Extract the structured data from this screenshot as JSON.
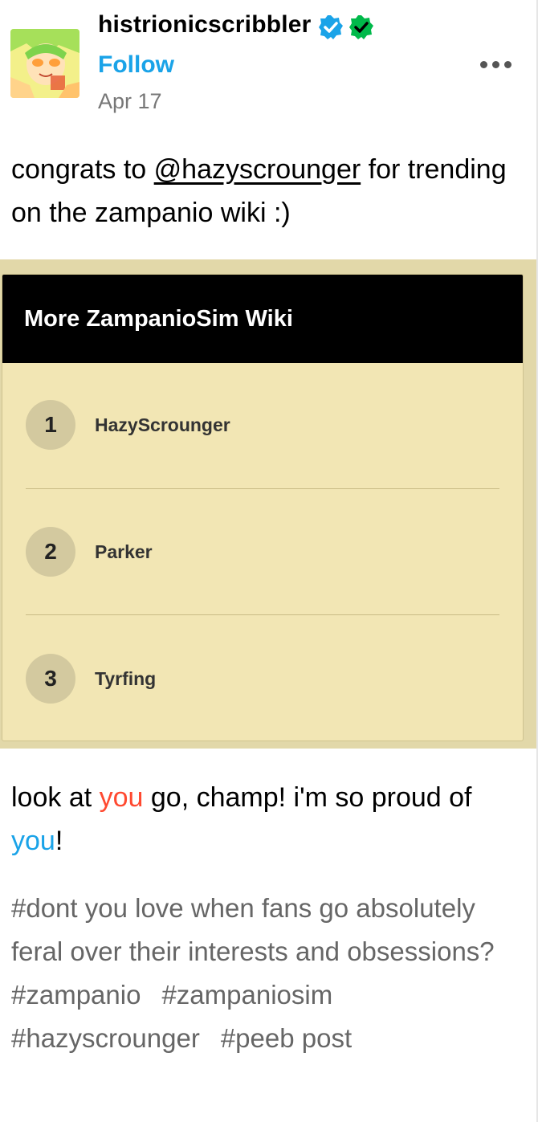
{
  "post": {
    "username": "histrionicscribbler",
    "follow_label": "Follow",
    "date": "Apr 17",
    "body_prefix": "congrats to ",
    "mention": "@hazyscrounger",
    "body_suffix": " for trending on the zampanio wiki :)"
  },
  "embed": {
    "title": "More ZampanioSim Wiki",
    "items": [
      {
        "rank": "1",
        "name": "HazyScrounger"
      },
      {
        "rank": "2",
        "name": "Parker"
      },
      {
        "rank": "3",
        "name": "Tyrfing"
      }
    ]
  },
  "reply": {
    "part1": "look at ",
    "you_red": "you",
    "part2": " go, champ! i'm so proud of ",
    "you_blue": "you",
    "part3": "!"
  },
  "tags": [
    "#dont you love when fans go absolutely feral over their interests and obsessions?",
    "#zampanio",
    "#zampaniosim",
    "#hazyscrounger",
    "#peeb post"
  ],
  "colors": {
    "accent_blue": "#1aa3e8",
    "accent_red": "#ff4930",
    "embed_bg": "#f2e6b4",
    "verified_green": "#00b94a"
  },
  "icons": [
    "verified-blue-icon",
    "verified-green-icon",
    "more-options-icon"
  ]
}
